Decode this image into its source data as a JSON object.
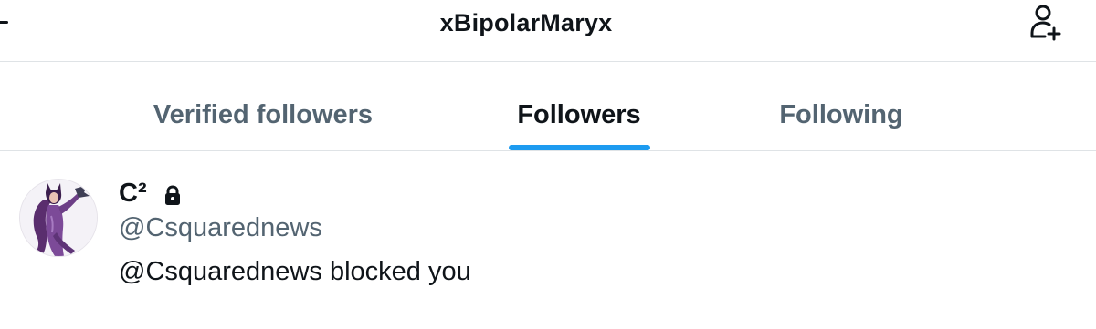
{
  "header": {
    "title": "xBipolarMaryx",
    "back_icon": "arrow-left-icon",
    "action_icon": "add-user-icon"
  },
  "tabs": [
    {
      "label": "Verified followers",
      "active": false
    },
    {
      "label": "Followers",
      "active": true
    },
    {
      "label": "Following",
      "active": false
    }
  ],
  "user": {
    "display_name": "C²",
    "handle": "@Csquarednews",
    "status": "@Csquarednews blocked you",
    "protected_icon": "lock-icon",
    "avatar_icon": "avatar-image"
  },
  "colors": {
    "accent": "#1d9bf0",
    "text_primary": "#0f1419",
    "text_secondary": "#536471",
    "divider": "#dfe3e6"
  }
}
